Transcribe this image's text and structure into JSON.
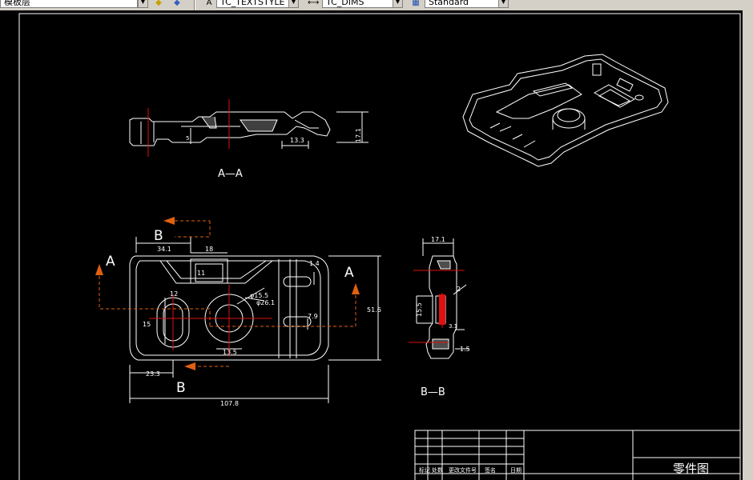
{
  "toolbar": {
    "layer_field": "模板层",
    "textstyle_field": "TC_TEXTSTYLE",
    "dimstyle_field": "TC_DIMS",
    "table_style_field": "Standard"
  },
  "drawing": {
    "section_aa_label": "A—A",
    "section_bb_label": "B—B",
    "cut_label_a_left": "A",
    "cut_label_a_right": "A",
    "cut_label_b_top": "B",
    "cut_label_b_bottom": "B",
    "dims": {
      "aa_height": "17.1",
      "aa_width": "13.3",
      "aa_small": "5",
      "w_34_1": "34.1",
      "w_18": "18",
      "w_11": "11",
      "w_12": "12",
      "w_15": "15",
      "w_23_3": "23.3",
      "w_13_5": "13.5",
      "w_107_8": "107.8",
      "w_51_6": "51.6",
      "w_7_9": "7.9",
      "w_1_4": "1.4",
      "d_15_5": "φ15.5",
      "d_26_1": "φ26.1",
      "bb_17_1": "17.1",
      "bb_15_5": "15.5",
      "bb_1_5": "1.5",
      "bb_2": "2",
      "bb_3_1": "3.1"
    }
  },
  "title_block": {
    "title": "零件图",
    "row_labels": [
      "标记",
      "处数",
      "更改文件号",
      "签名",
      "日期"
    ]
  },
  "colors": {
    "background": "#000000",
    "lines": "#ffffff",
    "cut_arrows": "#e06010",
    "center_lines": "#e01010"
  }
}
